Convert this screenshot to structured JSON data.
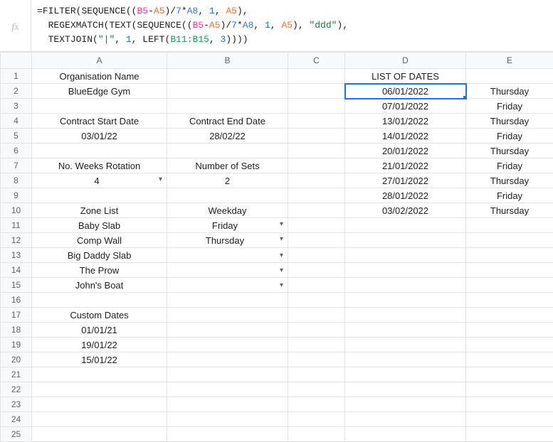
{
  "formula": {
    "line1_prefix": "=",
    "fn_filter": "FILTER",
    "fn_sequence": "SEQUENCE",
    "fn_regex": "REGEXMATCH",
    "fn_text": "TEXT",
    "fn_tj": "TEXTJOIN",
    "fn_left": "LEFT",
    "ref_b5": "B5",
    "ref_a5": "A5",
    "ref_a8": "A8",
    "ref_b11b15": "B11:B15",
    "num7": "7",
    "num1": "1",
    "num3": "3",
    "str_ddd": "\"ddd\"",
    "str_pipe": "\"|\""
  },
  "columns": [
    "A",
    "B",
    "C",
    "D",
    "E"
  ],
  "rows_count": 25,
  "colA": {
    "r1": "Organisation Name",
    "r2": "BlueEdge Gym",
    "r4": "Contract Start Date",
    "r5": "03/01/22",
    "r7": "No. Weeks Rotation",
    "r8": "4",
    "r10": "Zone List",
    "r11": "Baby Slab",
    "r12": "Comp Wall",
    "r13": "Big Daddy Slab",
    "r14": "The Prow",
    "r15": "John's Boat",
    "r17": "Custom Dates",
    "r18": "01/01/21",
    "r19": "19/01/22",
    "r20": "15/01/22"
  },
  "colB": {
    "r4": "Contract End Date",
    "r5": "28/02/22",
    "r7": "Number of Sets",
    "r8": "2",
    "r10": "Weekday",
    "r11": "Friday",
    "r12": "Thursday"
  },
  "colD": {
    "r1": "LIST OF DATES",
    "r2": "06/01/2022",
    "r3": "07/01/2022",
    "r4": "13/01/2022",
    "r5": "14/01/2022",
    "r6": "20/01/2022",
    "r7": "21/01/2022",
    "r8": "27/01/2022",
    "r9": "28/01/2022",
    "r10": "03/02/2022"
  },
  "colE": {
    "r2": "Thursday",
    "r3": "Friday",
    "r4": "Thursday",
    "r5": "Friday",
    "r6": "Thursday",
    "r7": "Friday",
    "r8": "Thursday",
    "r9": "Friday",
    "r10": "Thursday"
  },
  "active_cell": "D2"
}
